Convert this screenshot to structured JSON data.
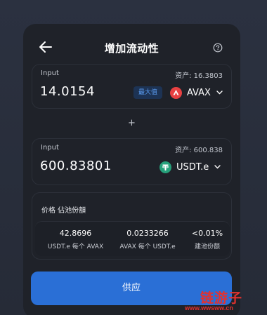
{
  "header": {
    "title": "增加流动性",
    "back_icon": "arrow-left-icon",
    "help_icon": "question-circle-icon"
  },
  "input1": {
    "label": "Input",
    "balance": "资产: 16.3803",
    "amount": "14.0154",
    "max_label": "最大值",
    "token": "AVAX",
    "token_icon": "avalanche-icon",
    "token_color": "#e84142"
  },
  "plus": "+",
  "input2": {
    "label": "Input",
    "balance": "资产: 600.838",
    "amount": "600.83801",
    "token": "USDT.e",
    "token_icon": "tether-icon",
    "token_color": "#26a17b"
  },
  "price": {
    "title": "价格 佔池份額",
    "stats": [
      {
        "value": "42.8696",
        "label": "USDT.e 每个 AVAX"
      },
      {
        "value": "0.0233266",
        "label": "AVAX 每个 USDT.e"
      },
      {
        "value": "<0.01%",
        "label": "建池份额"
      }
    ]
  },
  "supply_label": "供应",
  "watermark": {
    "main": "链游子",
    "url": "www.wwsww.cn"
  },
  "colors": {
    "accent": "#2a6fd6",
    "max_bg": "#1d3354",
    "max_text": "#5a9bef",
    "card_bg": "#1f2229",
    "watermark": "#e2322f"
  }
}
